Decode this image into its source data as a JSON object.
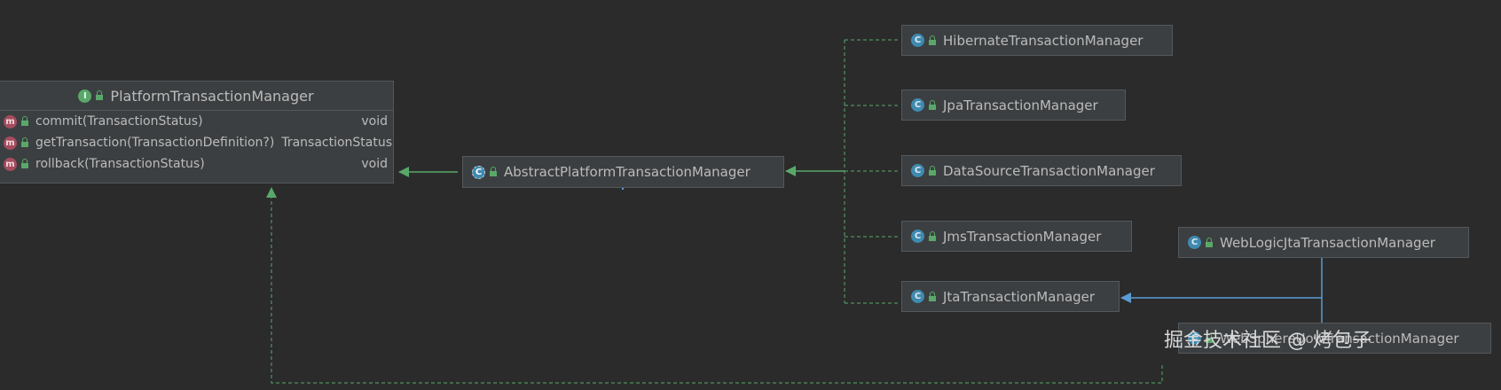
{
  "interface": {
    "name": "PlatformTransactionManager",
    "badge": "I",
    "methods": [
      {
        "badge": "m",
        "signature": "commit(TransactionStatus)",
        "returns": "void"
      },
      {
        "badge": "m",
        "signature": "getTransaction(TransactionDefinition?)",
        "returns": "TransactionStatus"
      },
      {
        "badge": "m",
        "signature": "rollback(TransactionStatus)",
        "returns": "void"
      }
    ]
  },
  "abstract_class": {
    "name": "AbstractPlatformTransactionManager",
    "badge": "C"
  },
  "implementations": [
    {
      "name": "HibernateTransactionManager",
      "badge": "C"
    },
    {
      "name": "JpaTransactionManager",
      "badge": "C"
    },
    {
      "name": "DataSourceTransactionManager",
      "badge": "C"
    },
    {
      "name": "JmsTransactionManager",
      "badge": "C"
    },
    {
      "name": "JtaTransactionManager",
      "badge": "C"
    }
  ],
  "jta_subclasses": [
    {
      "name": "WebLogicJtaTransactionManager",
      "badge": "C"
    },
    {
      "name": "WebSphereUowTransactionManager",
      "badge": "C"
    }
  ],
  "watermark": "掘金技术社区 @ 烤包子",
  "colors": {
    "background": "#2b2b2b",
    "node_fill": "#3c3f41",
    "implements_arrow": "#59a869",
    "extends_arrow": "#5b9bd5"
  }
}
